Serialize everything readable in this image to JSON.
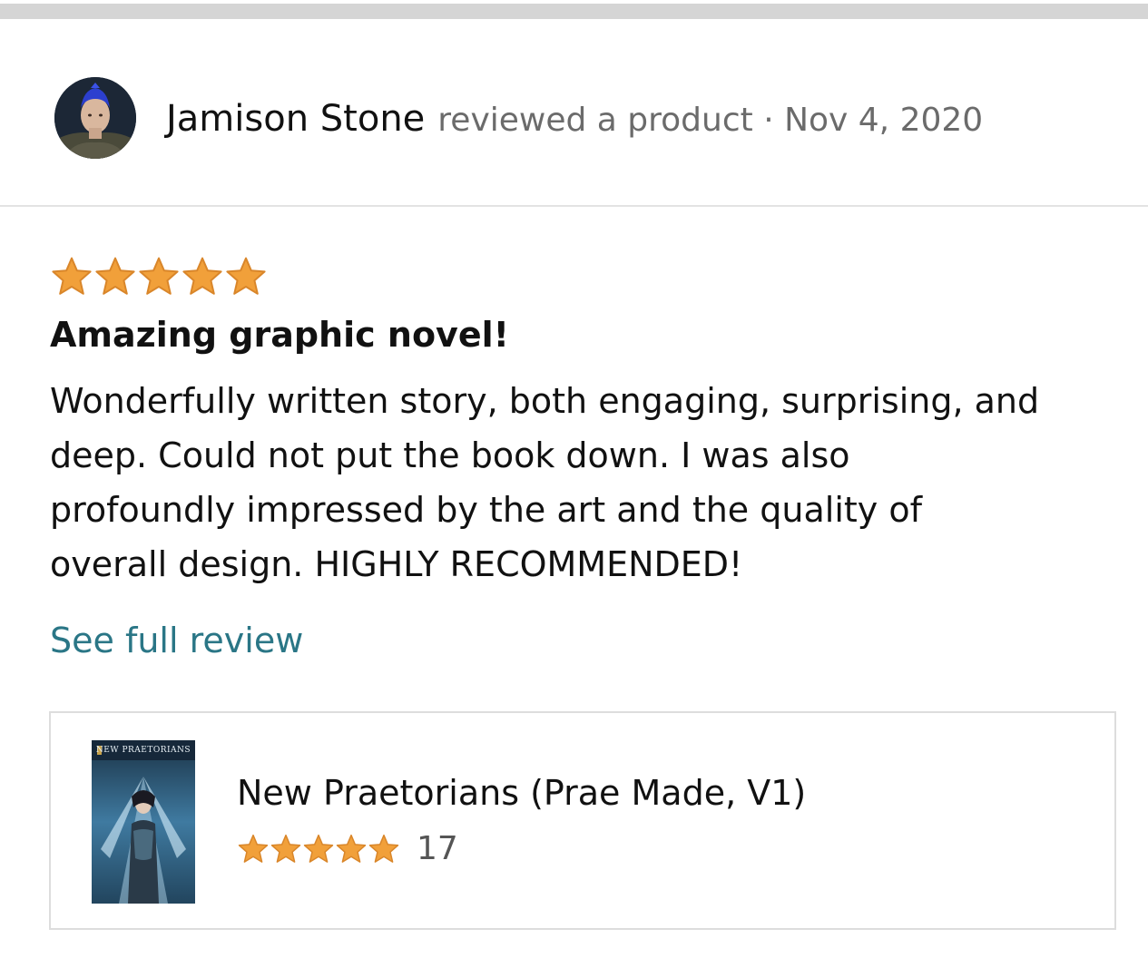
{
  "header": {
    "author_name": "Jamison Stone",
    "action_text": "reviewed a product · Nov 4, 2020"
  },
  "review": {
    "rating": 5,
    "rating_max": 5,
    "title": "Amazing graphic novel!",
    "body_lines": [
      "Wonderfully written story, both engaging, surprising, and",
      "deep. Could not put the book down. I was also",
      "profoundly impressed by the art and the quality of",
      "overall design. HIGHLY RECOMMENDED!"
    ],
    "see_full_label": "See full review"
  },
  "product": {
    "cover_title": "NEW PRAETORIANS",
    "title": "New Praetorians (Prae Made, V1)",
    "rating": 5,
    "rating_count": "17"
  },
  "colors": {
    "star": "#f1a03a",
    "star_stroke": "#d9862a",
    "link": "#2a7686",
    "meta_text": "#6b6b6b",
    "top_bar": "#d5d5d5",
    "divider": "#e3e3e3",
    "card_border": "#dddddd"
  },
  "icons": {
    "avatar": "user-avatar-photo",
    "star": "star-icon"
  }
}
